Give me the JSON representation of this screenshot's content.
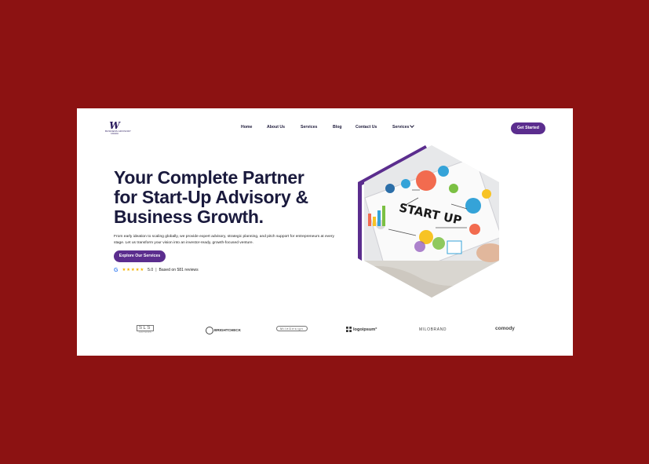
{
  "logo": {
    "mark": "W",
    "line1": "BUSINESS ADVISORY",
    "line2": "CANADA"
  },
  "nav": {
    "items": [
      "Home",
      "About Us",
      "Services",
      "Blog",
      "Contact Us",
      "Services"
    ],
    "cta": "Get Started"
  },
  "hero": {
    "title_lines": [
      "Your Complete Partner",
      "for Start-Up Advisory &",
      "Business Growth."
    ],
    "description": "From early ideation to scaling globally, we provide expert advisory, strategic planning, and pitch support for entrepreneurs at every stage. Let us transform your vision into an investor-ready, growth-focused venture.",
    "button": "Explore Our Services",
    "rating": {
      "google": "G",
      "stars": "★★★★★",
      "score": "5.0",
      "separator": "|",
      "text": "Based on 581 reviews"
    }
  },
  "illustration": {
    "board_text": "START UP"
  },
  "brands": {
    "sls": "SLS",
    "sls_sub": "ADVISORS",
    "bright_check": "BRIGHTCHECK",
    "mile_design": "MileDesign",
    "logoipsum": "logoipsum°",
    "milobrand": "MILOBRAND",
    "comedy": "comody"
  },
  "colors": {
    "page_bg": "#8c1212",
    "accent": "#5b2d8e",
    "title": "#1a1a3d"
  }
}
